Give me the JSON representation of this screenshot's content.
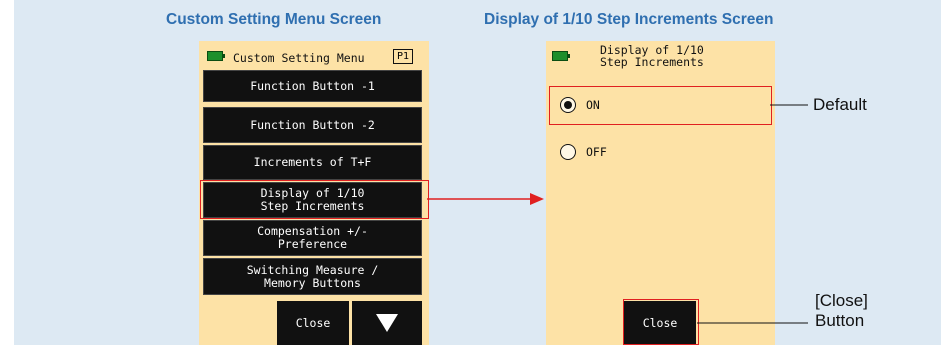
{
  "headers": {
    "left": "Custom Setting Menu Screen",
    "right": "Display of 1/10 Step Increments Screen"
  },
  "left_screen": {
    "title": "Custom Setting Menu",
    "page_badge": "P1",
    "menu_items": [
      "Function Button -1",
      "Function Button -2",
      "Increments of T+F",
      "Display of 1/10\nStep Increments",
      "Compensation +/-\nPreference",
      "Switching Measure /\nMemory Buttons"
    ],
    "selected_index": 3,
    "close_label": "Close",
    "next_icon": "triangle-down-icon"
  },
  "right_screen": {
    "title": "Display of 1/10\nStep Increments",
    "options": [
      {
        "label": "ON",
        "selected": true
      },
      {
        "label": "OFF",
        "selected": false
      }
    ],
    "close_label": "Close"
  },
  "callouts": {
    "default": "Default",
    "close": "[Close]\nButton"
  },
  "colors": {
    "header_text": "#2f6fb0",
    "screen_bg": "#fde2a6",
    "highlight": "#e02020",
    "panel_bg": "#dde9f3"
  }
}
